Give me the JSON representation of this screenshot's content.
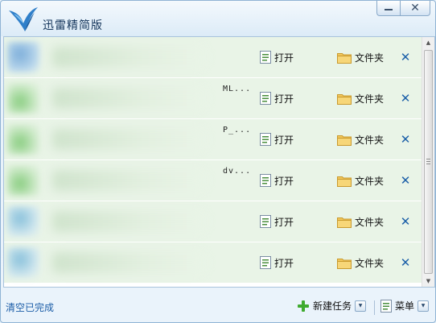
{
  "window": {
    "title": "迅雷精简版",
    "minimize_label": "minimize",
    "close_label": "close"
  },
  "tasks": [
    {
      "name_tail": "",
      "thumb": "blue",
      "open_label": "打开",
      "folder_label": "文件夹"
    },
    {
      "name_tail": "ML...",
      "thumb": "green",
      "open_label": "打开",
      "folder_label": "文件夹"
    },
    {
      "name_tail": "P_...",
      "thumb": "green",
      "open_label": "打开",
      "folder_label": "文件夹"
    },
    {
      "name_tail": "dv...",
      "thumb": "green",
      "open_label": "打开",
      "folder_label": "文件夹"
    },
    {
      "name_tail": "",
      "thumb": "teal",
      "open_label": "打开",
      "folder_label": "文件夹"
    },
    {
      "name_tail": "",
      "thumb": "teal",
      "open_label": "打开",
      "folder_label": "文件夹"
    }
  ],
  "footer": {
    "clear_label": "清空已完成",
    "new_task_label": "新建任务",
    "menu_label": "菜单"
  },
  "icons": {
    "logo": "xunlei-bird-icon",
    "open": "document-icon",
    "folder": "folder-icon",
    "delete": "delete-x-icon",
    "new_task": "plus-icon",
    "menu": "menu-document-icon"
  },
  "colors": {
    "accent": "#1d5ea8",
    "row_bg": "#e9f4e7",
    "folder": "#f2c75c",
    "plus": "#3faa2f"
  }
}
